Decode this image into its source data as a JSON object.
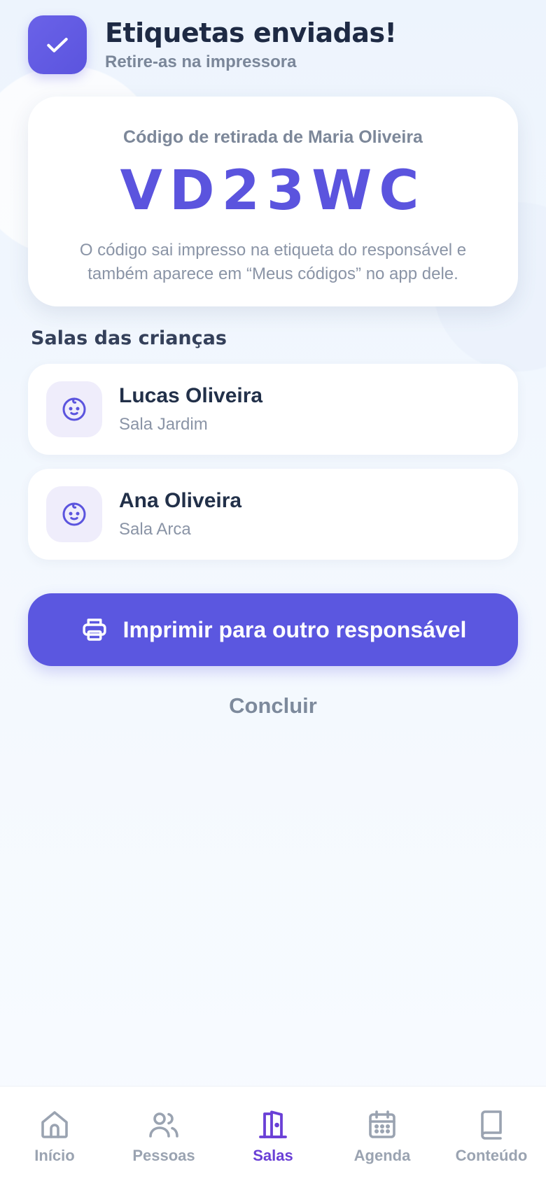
{
  "header": {
    "title": "Etiquetas enviadas!",
    "subtitle": "Retire-as na impressora"
  },
  "code_card": {
    "label": "Código de retirada de Maria Oliveira",
    "code": "VD23WC",
    "note": "O código sai impresso na etiqueta do responsável e também aparece em “Meus códigos” no app dele."
  },
  "children_section": {
    "title": "Salas das crianças",
    "items": [
      {
        "name": "Lucas Oliveira",
        "room": "Sala Jardim",
        "icon": "baby-face-icon"
      },
      {
        "name": "Ana Oliveira",
        "room": "Sala Arca",
        "icon": "baby-face-icon"
      }
    ]
  },
  "actions": {
    "print_label": "Imprimir para outro responsável",
    "conclude_label": "Concluir"
  },
  "nav": {
    "items": [
      {
        "label": "Início",
        "icon": "home-icon",
        "active": false
      },
      {
        "label": "Pessoas",
        "icon": "people-icon",
        "active": false
      },
      {
        "label": "Salas",
        "icon": "door-icon",
        "active": true
      },
      {
        "label": "Agenda",
        "icon": "calendar-icon",
        "active": false
      },
      {
        "label": "Conteúdo",
        "icon": "book-icon",
        "active": false
      }
    ]
  },
  "colors": {
    "accent": "#5b57e0",
    "nav_active": "#6a3fd6",
    "text_dark": "#1e2a44",
    "text_muted": "#8a94a6"
  }
}
